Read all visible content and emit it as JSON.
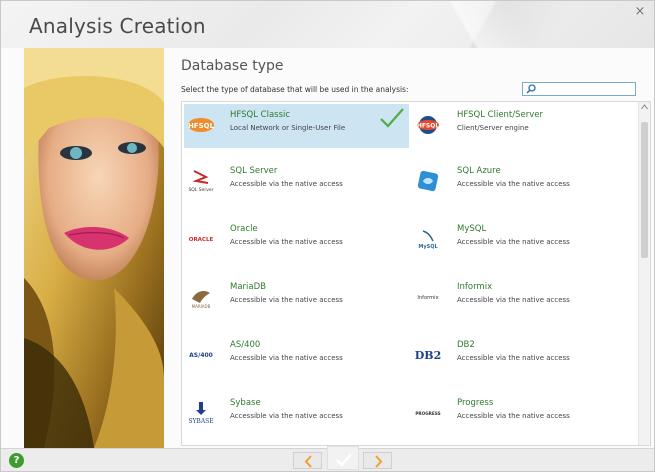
{
  "window": {
    "title": "Analysis Creation",
    "close_label": "×"
  },
  "header": {
    "section_title": "Database type",
    "instruction": "Select the type of database that will be used in the analysis:"
  },
  "search": {
    "placeholder": ""
  },
  "databases": [
    {
      "name": "HFSQL Classic",
      "desc": "Local Network or Single-User File",
      "logo": "HFSQL",
      "selected": true
    },
    {
      "name": "HFSQL Client/Server",
      "desc": "Client/Server engine",
      "logo": "HFSQL",
      "selected": false
    },
    {
      "name": "SQL Server",
      "desc": "Accessible via the native access",
      "logo": "SQL Server",
      "selected": false
    },
    {
      "name": "SQL Azure",
      "desc": "Accessible via the native access",
      "logo": "",
      "selected": false
    },
    {
      "name": "Oracle",
      "desc": "Accessible via the native access",
      "logo": "ORACLE",
      "selected": false
    },
    {
      "name": "MySQL",
      "desc": "Accessible via the native access",
      "logo": "MySQL",
      "selected": false
    },
    {
      "name": "MariaDB",
      "desc": "Accessible via the native access",
      "logo": "MARIADB",
      "selected": false
    },
    {
      "name": "Informix",
      "desc": "Accessible via the native access",
      "logo": "Informix",
      "selected": false
    },
    {
      "name": "AS/400",
      "desc": "Accessible via the native access",
      "logo": "AS/400",
      "selected": false
    },
    {
      "name": "DB2",
      "desc": "Accessible via the native access",
      "logo": "DB2",
      "selected": false
    },
    {
      "name": "Sybase",
      "desc": "Accessible via the native access",
      "logo": "SYBASE",
      "selected": false
    },
    {
      "name": "Progress",
      "desc": "Accessible via the native access",
      "logo": "PROGRESS",
      "selected": false
    }
  ],
  "footer": {
    "help_label": "?"
  },
  "colors": {
    "accent_green": "#2f7a2f",
    "selection": "#cde4f2",
    "nav_orange": "#f0a030"
  }
}
